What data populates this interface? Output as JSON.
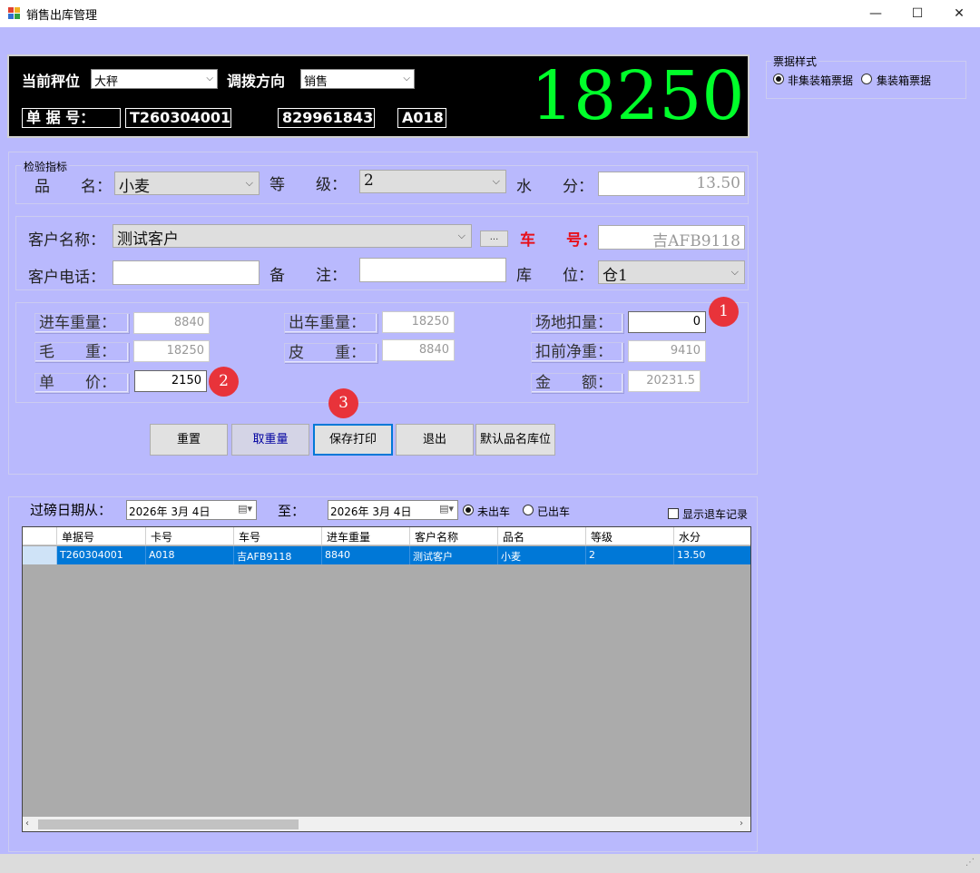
{
  "window": {
    "title": "销售出库管理",
    "minimize": "—",
    "maximize": "☐",
    "close": "✕"
  },
  "scale": {
    "scale_label": "当前秤位",
    "scale_value": "大秤",
    "direction_label": "调拨方向",
    "direction_value": "销售",
    "doc_no_label": "单 据 号：",
    "doc_no": "T260304001",
    "card_no": "829961843",
    "card_code": "A018",
    "weight": "18250"
  },
  "ticket_style": {
    "title": "票据样式",
    "options": [
      {
        "label": "非集装箱票据",
        "selected": true
      },
      {
        "label": "集装箱票据",
        "selected": false
      }
    ]
  },
  "inspection": {
    "title": "检验指标",
    "product_label": "品　　名：",
    "product_value": "小麦",
    "grade_label": "等　　级：",
    "grade_value": "2",
    "moisture_label": "水　　分：",
    "moisture_value": "13.50"
  },
  "customer": {
    "name_label": "客户名称：",
    "name_value": "测试客户",
    "browse_label": "...",
    "plate_label": "车　　号：",
    "plate_value": "吉AFB9118",
    "phone_label": "客户电话：",
    "phone_value": "",
    "remark_label": "备　　注：",
    "remark_value": "",
    "warehouse_label": "库　　位：",
    "warehouse_value": "仓1"
  },
  "weights": {
    "in_weight_label": "进车重量：",
    "in_weight": "8840",
    "out_weight_label": "出车重量：",
    "out_weight": "18250",
    "site_deduct_label": "场地扣量：",
    "site_deduct": "0",
    "gross_label": "毛　　重：",
    "gross": "18250",
    "tare_label": "皮　　重：",
    "tare": "8840",
    "pre_deduct_net_label": "扣前净重：",
    "pre_deduct_net": "9410",
    "unit_price_label": "单　　价：",
    "unit_price": "2150",
    "amount_label": "金　　额：",
    "amount": "20231.5"
  },
  "badges": {
    "b1": "1",
    "b2": "2",
    "b3": "3"
  },
  "buttons": {
    "reset": "重置",
    "get_weight": "取重量",
    "save_print": "保存打印",
    "exit": "退出",
    "default_location": "默认品名库位"
  },
  "filter": {
    "from_label": "过磅日期从：",
    "from_date": "2026年  3月  4日",
    "to_label": "至：",
    "to_date": "2026年  3月  4日",
    "not_out_label": "未出车",
    "out_label": "已出车",
    "show_returned_label": "显示退车记录"
  },
  "table": {
    "columns": [
      "单据号",
      "卡号",
      "车号",
      "进车重量",
      "客户名称",
      "品名",
      "等级",
      "水分"
    ],
    "rows": [
      [
        "T260304001",
        "A018",
        "吉AFB9118",
        "8840",
        "测试客户",
        "小麦",
        "2",
        "13.50"
      ]
    ]
  },
  "colors": {
    "background": "#b9b9fd",
    "weight_display": "#00ff2a",
    "badge": "#e8333a",
    "selection": "#0078d7",
    "plate_label": "#e8101a"
  }
}
